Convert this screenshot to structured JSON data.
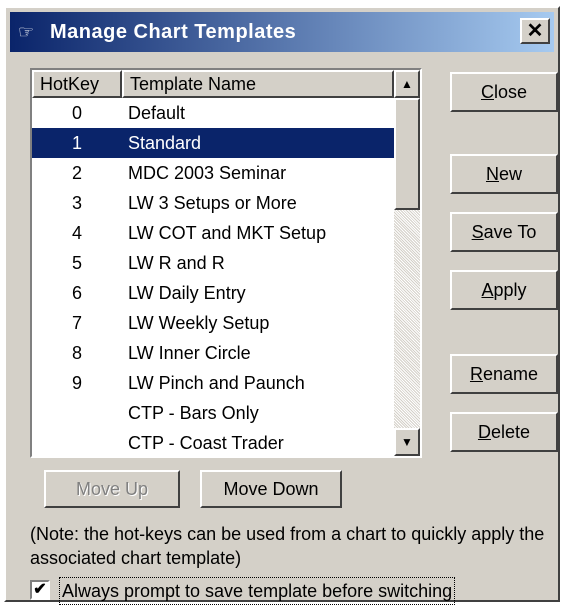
{
  "window": {
    "title": "Manage Chart Templates",
    "title_icon": "hand-pointer-icon",
    "close_glyph": "✕"
  },
  "list": {
    "columns": [
      "HotKey",
      "Template Name"
    ],
    "rows": [
      {
        "hotkey": "0",
        "name": "Default"
      },
      {
        "hotkey": "1",
        "name": "Standard",
        "selected": true
      },
      {
        "hotkey": "2",
        "name": "MDC 2003 Seminar"
      },
      {
        "hotkey": "3",
        "name": "LW 3 Setups or More"
      },
      {
        "hotkey": "4",
        "name": "LW COT and MKT Setup"
      },
      {
        "hotkey": "5",
        "name": "LW R and R"
      },
      {
        "hotkey": "6",
        "name": "LW Daily Entry"
      },
      {
        "hotkey": "7",
        "name": "LW Weekly Setup"
      },
      {
        "hotkey": "8",
        "name": "LW Inner Circle"
      },
      {
        "hotkey": "9",
        "name": "LW Pinch and Paunch"
      },
      {
        "hotkey": "",
        "name": "CTP - Bars Only"
      },
      {
        "hotkey": "",
        "name": "CTP - Coast Trader"
      }
    ],
    "scroll_up_glyph": "▲",
    "scroll_down_glyph": "▼"
  },
  "buttons": {
    "close": {
      "first": "C",
      "rest": "lose"
    },
    "new": {
      "first": "N",
      "rest": "ew"
    },
    "save_to": {
      "first": "S",
      "rest": "ave To"
    },
    "apply": {
      "first": "A",
      "rest": "pply"
    },
    "rename": {
      "first": "R",
      "rest": "ename"
    },
    "delete": {
      "first": "D",
      "rest": "elete"
    },
    "move_up": "Move Up",
    "move_down": "Move Down"
  },
  "note": "(Note: the hot-keys can be used from a chart to quickly apply the associated chart template)",
  "checkbox": {
    "label": "Always prompt to save template before switching",
    "checked": true,
    "check_glyph": "✔"
  }
}
